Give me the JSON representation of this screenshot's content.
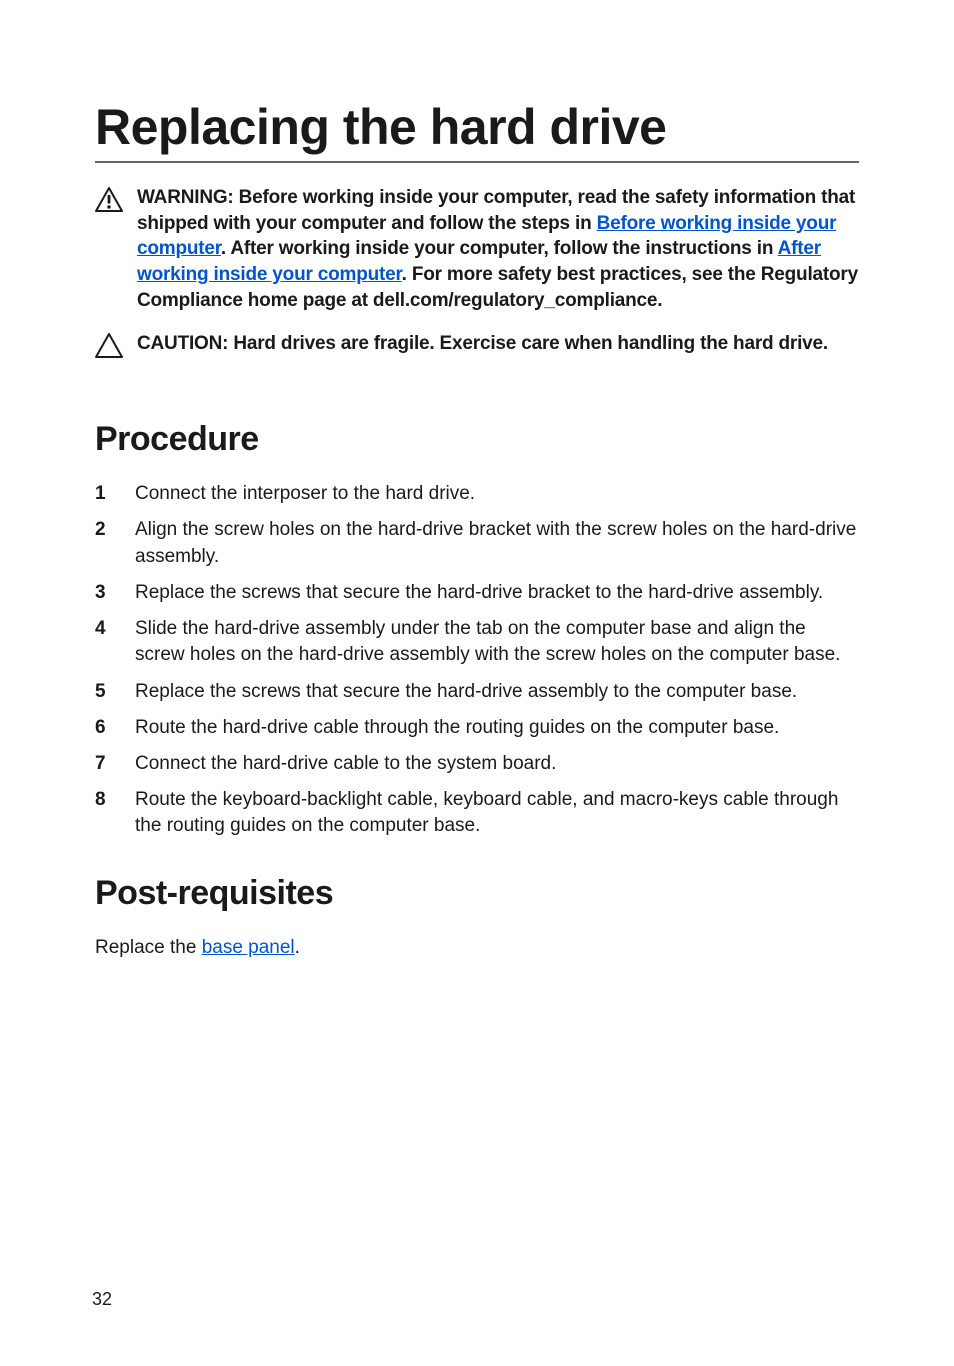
{
  "page_number": "32",
  "title": "Replacing the hard drive",
  "alerts": {
    "warning": {
      "text_pre": "WARNING: Before working inside your computer, read the safety information that shipped with your computer and follow the steps in ",
      "link1_text": "Before working inside your computer",
      "text_mid": ". After working inside your computer, follow the instructions in ",
      "link2_text": "After working inside your computer",
      "text_post": ". For more safety best practices, see the Regulatory Compliance home page at dell.com/regulatory_compliance."
    },
    "caution": "CAUTION: Hard drives are fragile. Exercise care when handling the hard drive."
  },
  "sections": {
    "procedure": {
      "heading": "Procedure",
      "steps": [
        "Connect the interposer to the hard drive.",
        "Align the screw holes on the hard-drive bracket with the screw holes on the hard-drive assembly.",
        "Replace the screws that secure the hard-drive bracket to the hard-drive assembly.",
        "Slide the hard-drive assembly under the tab on the computer base and align the screw holes on the hard-drive assembly with the screw holes on the computer base.",
        "Replace the screws that secure the hard-drive assembly to the computer base.",
        "Route the hard-drive cable through the routing guides on the computer base.",
        "Connect the hard-drive cable to the system board.",
        "Route the keyboard-backlight cable, keyboard cable, and macro-keys cable through the routing guides on the computer base."
      ]
    },
    "postreq": {
      "heading": "Post-requisites",
      "text_pre": "Replace the ",
      "link_text": "base panel",
      "text_post": "."
    }
  }
}
